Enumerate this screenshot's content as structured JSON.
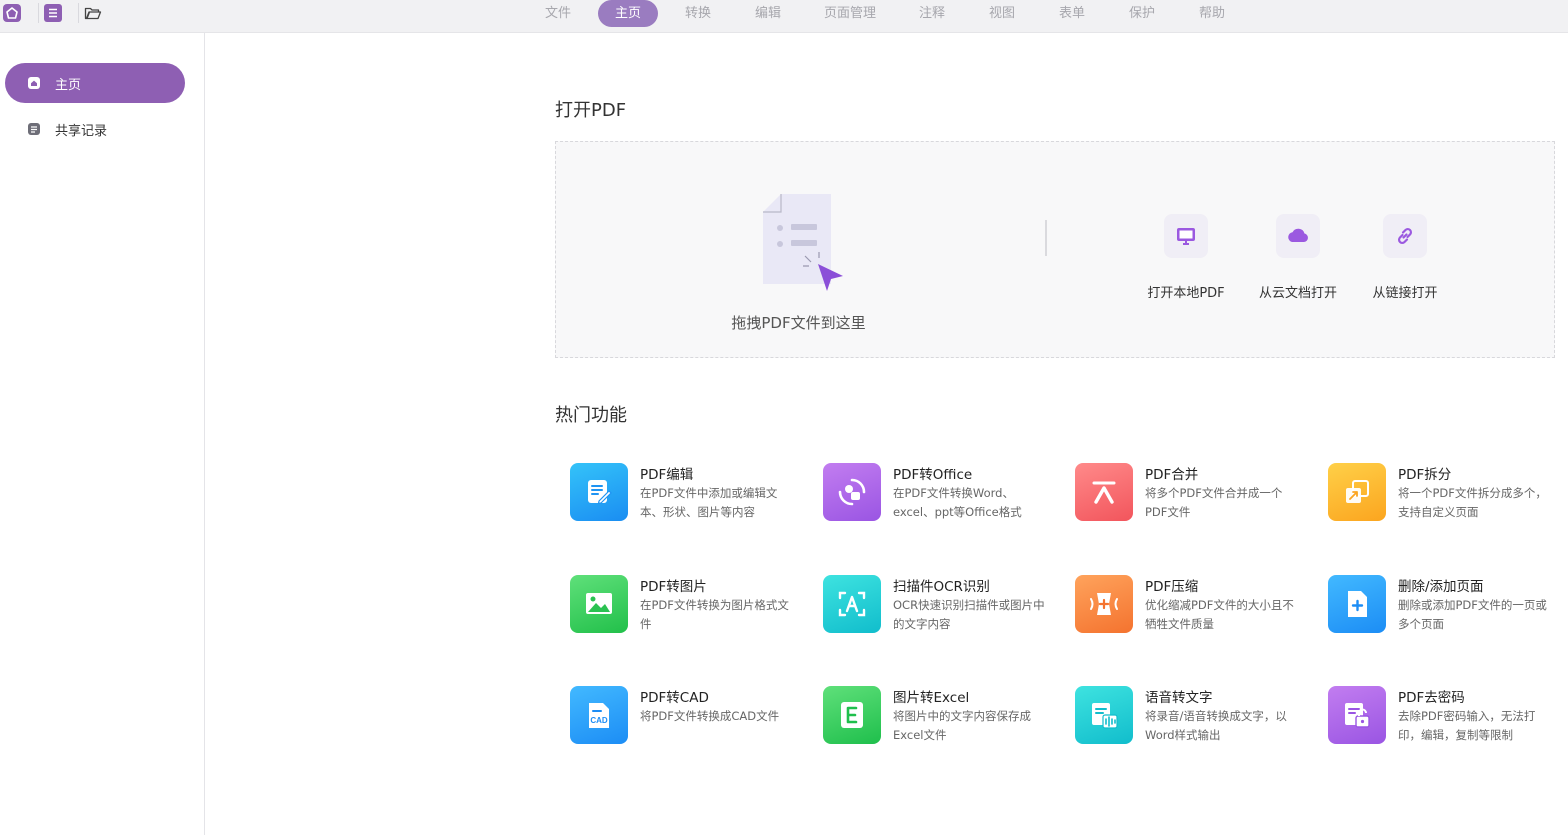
{
  "menu": {
    "tabs": [
      "文件",
      "主页",
      "转换",
      "编辑",
      "页面管理",
      "注释",
      "视图",
      "表单",
      "保护",
      "帮助"
    ],
    "active": "主页"
  },
  "sidebar": {
    "items": [
      {
        "label": "主页",
        "icon": "home-icon",
        "active": true
      },
      {
        "label": "共享记录",
        "icon": "document-icon",
        "active": false
      }
    ]
  },
  "open_section": {
    "title": "打开PDF",
    "drop_text": "拖拽PDF文件到这里",
    "options": [
      {
        "label": "打开本地PDF",
        "icon": "monitor-icon"
      },
      {
        "label": "从云文档打开",
        "icon": "cloud-icon"
      },
      {
        "label": "从链接打开",
        "icon": "link-icon"
      }
    ]
  },
  "hot_section": {
    "title": "热门功能",
    "features": [
      {
        "title": "PDF编辑",
        "desc": "在PDF文件中添加或编辑文本、形状、图片等内容",
        "icon": "edit-icon",
        "color_from": "#34c3f9",
        "color_to": "#1a8df2"
      },
      {
        "title": "PDF转Office",
        "desc": "在PDF文件转换Word、excel、ppt等Office格式",
        "icon": "convert-icon",
        "color_from": "#c27df0",
        "color_to": "#9a55e3"
      },
      {
        "title": "PDF合并",
        "desc": "将多个PDF文件合并成一个PDF文件",
        "icon": "merge-icon",
        "color_from": "#ff8a8a",
        "color_to": "#f2555c"
      },
      {
        "title": "PDF拆分",
        "desc": "将一个PDF文件拆分成多个， 支持自定义页面",
        "icon": "split-icon",
        "color_from": "#ffd048",
        "color_to": "#fba51f"
      },
      {
        "title": "PDF转图片",
        "desc": "在PDF文件转换为图片格式文件",
        "icon": "image-icon",
        "color_from": "#5fe07a",
        "color_to": "#22c04a"
      },
      {
        "title": "扫描件OCR识别",
        "desc": "OCR快速识别扫描件或图片中的文字内容",
        "icon": "ocr-icon",
        "color_from": "#3ee3e0",
        "color_to": "#11bdcc"
      },
      {
        "title": "PDF压缩",
        "desc": "优化缩减PDF文件的大小且不牺牲文件质量",
        "icon": "compress-icon",
        "color_from": "#ffa35c",
        "color_to": "#f4732f"
      },
      {
        "title": "删除/添加页面",
        "desc": "删除或添加PDF文件的一页或多个页面",
        "icon": "add-page-icon",
        "color_from": "#42b9ff",
        "color_to": "#1c8df5"
      },
      {
        "title": "PDF转CAD",
        "desc": "将PDF文件转换成CAD文件",
        "icon": "cad-icon",
        "color_from": "#42b9ff",
        "color_to": "#1c8df5"
      },
      {
        "title": "图片转Excel",
        "desc": "将图片中的文字内容保存成Excel文件",
        "icon": "excel-icon",
        "color_from": "#5fe07a",
        "color_to": "#1fbf4c"
      },
      {
        "title": "语音转文字",
        "desc": "将录音/语音转换成文字，以Word样式输出",
        "icon": "voice-icon",
        "color_from": "#3ee3e0",
        "color_to": "#11bdcc"
      },
      {
        "title": "PDF去密码",
        "desc": "去除PDF密码输入，无法打印，编辑，复制等限制",
        "icon": "unlock-icon",
        "color_from": "#c27df0",
        "color_to": "#9a55e3"
      }
    ]
  },
  "colors": {
    "accent": "#8e5fb3",
    "tab_active": "#9a7cc0"
  }
}
